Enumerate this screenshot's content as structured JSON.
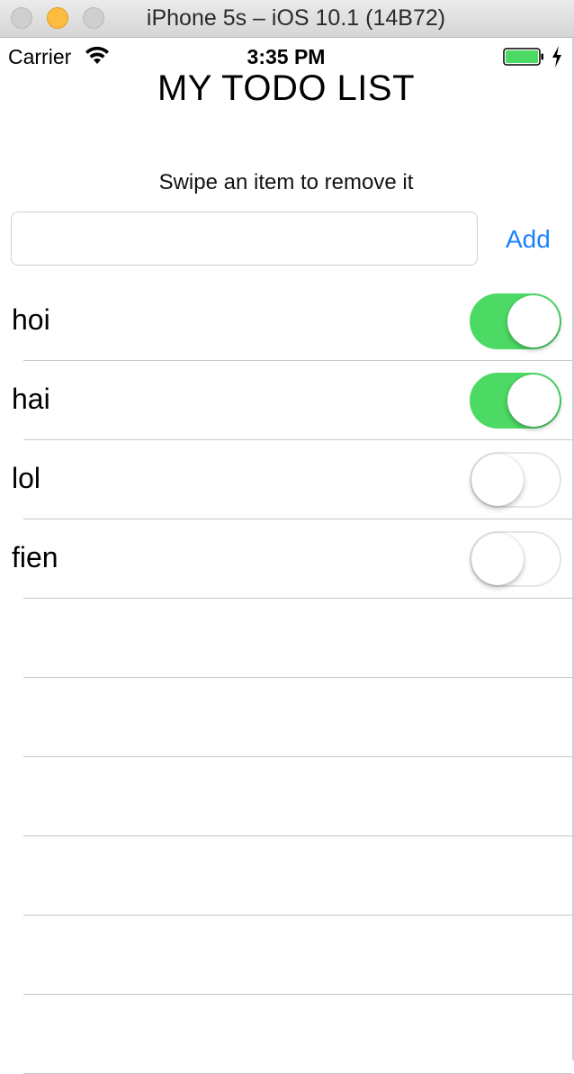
{
  "window": {
    "title": "iPhone 5s – iOS 10.1 (14B72)"
  },
  "status_bar": {
    "carrier": "Carrier",
    "time": "3:35 PM",
    "battery_color": "#4cd964"
  },
  "app": {
    "title": "MY TODO LIST",
    "hint": "Swipe an item to remove it",
    "input": {
      "value": "",
      "placeholder": ""
    },
    "add_label": "Add",
    "accent_color": "#1a82fb",
    "toggle_on_color": "#4cd964",
    "items": [
      {
        "label": "hoi",
        "done": true
      },
      {
        "label": "hai",
        "done": true
      },
      {
        "label": "lol",
        "done": false
      },
      {
        "label": "fien",
        "done": false
      }
    ],
    "empty_rows": 6
  }
}
